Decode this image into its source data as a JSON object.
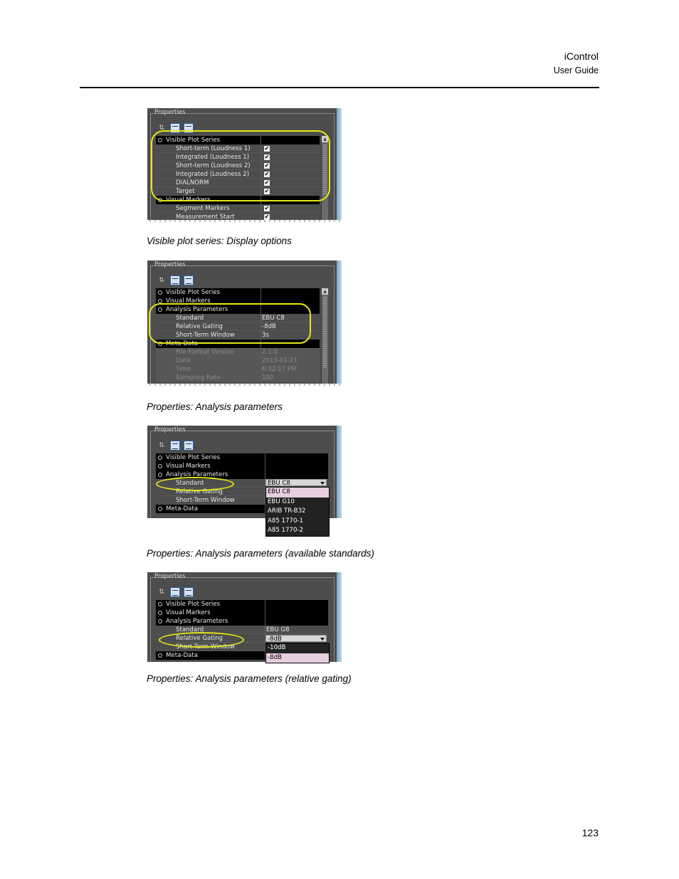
{
  "header": {
    "title": "iControl",
    "subtitle": "User Guide"
  },
  "page_number": "123",
  "figures": [
    {
      "caption": "Visible plot series: Display options",
      "panel_label": "Properties",
      "rows": [
        {
          "type": "group",
          "label": "Visible Plot Series",
          "value": ""
        },
        {
          "type": "item",
          "label": "Short-term (Loudness 1)",
          "checked": true
        },
        {
          "type": "item",
          "label": "Integrated (Loudness 1)",
          "checked": true
        },
        {
          "type": "item",
          "label": "Short-term (Loudness 2)",
          "checked": true
        },
        {
          "type": "item",
          "label": "Integrated (Loudness 2)",
          "checked": true
        },
        {
          "type": "item",
          "label": "DIALNORM",
          "checked": true
        },
        {
          "type": "item",
          "label": "Target",
          "checked": true
        },
        {
          "type": "group",
          "label": "Visual Markers",
          "value": ""
        },
        {
          "type": "item",
          "label": "Segment Markers",
          "checked": true
        },
        {
          "type": "item",
          "label": "Measurement Start",
          "checked": true
        }
      ]
    },
    {
      "caption": "Properties: Analysis parameters",
      "panel_label": "Properties",
      "rows": [
        {
          "type": "group",
          "label": "Visible Plot Series",
          "value": ""
        },
        {
          "type": "group",
          "label": "Visual Markers",
          "value": ""
        },
        {
          "type": "group",
          "label": "Analysis Parameters",
          "value": ""
        },
        {
          "type": "item",
          "label": "Standard",
          "value": "EBU C8"
        },
        {
          "type": "item",
          "label": "Relative Gating",
          "value": "-8dB"
        },
        {
          "type": "item",
          "label": "Short-Term Window",
          "value": "3s"
        },
        {
          "type": "group",
          "label": "Meta-Data",
          "value": ""
        },
        {
          "type": "dim",
          "label": "File Format Version",
          "value": "2.1.0"
        },
        {
          "type": "dim",
          "label": "Date",
          "value": "2013-01-21"
        },
        {
          "type": "dim",
          "label": "Time",
          "value": "6:32:17 PM"
        },
        {
          "type": "dim",
          "label": "Sampling Rate",
          "value": "100"
        }
      ]
    },
    {
      "caption": "Properties: Analysis parameters (available standards)",
      "panel_label": "Properties",
      "rows": [
        {
          "type": "group",
          "label": "Visible Plot Series",
          "value": ""
        },
        {
          "type": "group",
          "label": "Visual Markers",
          "value": ""
        },
        {
          "type": "group",
          "label": "Analysis Parameters",
          "value": ""
        },
        {
          "type": "item",
          "label": "Standard",
          "value": ""
        },
        {
          "type": "item",
          "label": "Relative Gating",
          "value": ""
        },
        {
          "type": "item",
          "label": "Short-Term Window",
          "value": ""
        },
        {
          "type": "group",
          "label": "Meta-Data",
          "value": ""
        }
      ],
      "combo_value": "EBU C8",
      "options": [
        "EBU C8",
        "EBU G10",
        "ARIB TR-B32",
        "A85 1770-1",
        "A85 1770-2"
      ],
      "selected_option": "EBU C8"
    },
    {
      "caption": "Properties: Analysis parameters (relative gating)",
      "panel_label": "Properties",
      "rows": [
        {
          "type": "group",
          "label": "Visible Plot Series",
          "value": ""
        },
        {
          "type": "group",
          "label": "Visual Markers",
          "value": ""
        },
        {
          "type": "group",
          "label": "Analysis Parameters",
          "value": ""
        },
        {
          "type": "item",
          "label": "Standard",
          "value": "EBU G8"
        },
        {
          "type": "item",
          "label": "Relative Gating",
          "value": ""
        },
        {
          "type": "item",
          "label": "Short-Term Window",
          "value": ""
        },
        {
          "type": "group",
          "label": "Meta-Data",
          "value": ""
        }
      ],
      "combo_value": "-8dB",
      "options": [
        "-10dB",
        "-8dB"
      ],
      "selected_option": "-8dB"
    }
  ]
}
